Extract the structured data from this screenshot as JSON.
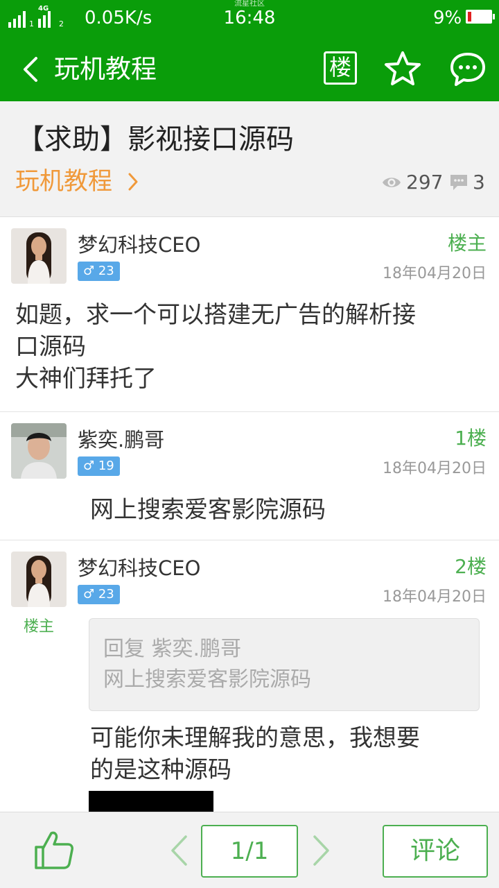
{
  "statusbar": {
    "network_tag": "4G",
    "sim1": "1",
    "sim2": "2",
    "speed": "0.05K/s",
    "app_name": "流星社区",
    "time": "16:48",
    "battery": "9%"
  },
  "appbar": {
    "title": "玩机教程",
    "floor_label": "楼",
    "icons": [
      "back-icon",
      "floor-icon",
      "star-icon",
      "chat-icon"
    ]
  },
  "thread": {
    "title": "【求助】影视接口源码",
    "category": "玩机教程",
    "views": "297",
    "comments": "3"
  },
  "posts": [
    {
      "username": "梦幻科技CEO",
      "level": "♂ 23",
      "floor": "楼主",
      "date": "18年04月20日",
      "body_lines": [
        "如题，求一个可以搭建无广告的解析接",
        "口源码",
        "大神们拜托了"
      ]
    },
    {
      "username": "紫奕.鹏哥",
      "level": "♂ 19",
      "floor": "1楼",
      "date": "18年04月20日",
      "body_lines": [
        "网上搜索爱客影院源码"
      ]
    },
    {
      "username": "梦幻科技CEO",
      "level": "♂ 23",
      "floor": "2楼",
      "date": "18年04月20日",
      "op_tag": "楼主",
      "quote_lines": [
        "回复 紫奕.鹏哥",
        "网上搜索爱客影院源码"
      ],
      "body_lines": [
        "可能你未理解我的意思，我想要",
        "的是这种源码"
      ]
    }
  ],
  "bottombar": {
    "page": "1/1",
    "comment_label": "评论"
  },
  "colors": {
    "brand_green": "#0a9d0a",
    "accent_green": "#4caf50",
    "category_orange": "#f0993a",
    "badge_blue": "#58a8e8"
  }
}
